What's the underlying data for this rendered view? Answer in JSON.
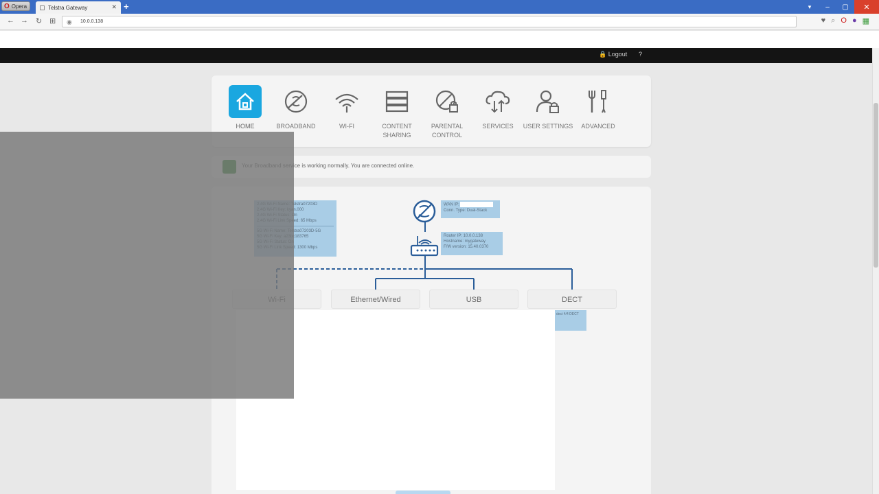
{
  "browser": {
    "menu_label": "Opera",
    "tab_title": "Telstra Gateway",
    "tab_close": "✕",
    "new_tab": "+",
    "url": "10.0.0.138",
    "window_controls": [
      "▾",
      "–",
      "▢",
      "✕"
    ]
  },
  "header": {
    "logout_label": "Logout",
    "help_label": "?"
  },
  "nav": {
    "items": [
      {
        "label": "HOME",
        "icon": "home-icon",
        "active": true
      },
      {
        "label": "BROADBAND",
        "icon": "broadband-icon"
      },
      {
        "label": "WI-FI",
        "icon": "wifi-icon"
      },
      {
        "label": "CONTENT SHARING",
        "icon": "content-sharing-icon"
      },
      {
        "label": "PARENTAL CONTROL",
        "icon": "parental-control-icon"
      },
      {
        "label": "SERVICES",
        "icon": "services-icon"
      },
      {
        "label": "USER SETTINGS",
        "icon": "user-settings-icon"
      },
      {
        "label": "ADVANCED",
        "icon": "advanced-icon"
      }
    ]
  },
  "status": {
    "message": "Your Broadband service is working normally.  You are connected online."
  },
  "diagram": {
    "wifi_info_24": [
      "2.4G Wi-Fi Name: Telstra07203D",
      "2.4G Wi-Fi Key: kyan.000",
      "2.4G Wi-Fi Status: On",
      "2.4G Wi-Fi Link Speed: 65 Mbps"
    ],
    "wifi_info_5": [
      "5G Wi-Fi Name: Telstra07203D-5G",
      "5G Wi-Fi Key: a23bc183765",
      "5G Wi-Fi Status: On",
      "5G Wi-Fi Link Speed: 1300 Mbps"
    ],
    "wan_ip_label": "WAN IP:",
    "conn_type": "Conn. Type: Dual-Stack",
    "router_info": [
      "Router IP: 10.0.0.138",
      "Hostname: mygateway",
      "F/W version: 15.40.0370"
    ],
    "dect_info": "dect 4/4 DECT",
    "tabs": [
      {
        "label": "Wi-Fi",
        "name": "tab-wifi"
      },
      {
        "label": "Ethernet/Wired",
        "name": "tab-ethernet"
      },
      {
        "label": "USB",
        "name": "tab-usb"
      },
      {
        "label": "DECT",
        "name": "tab-dect"
      }
    ],
    "line_color": "#2a5d99"
  },
  "colors": {
    "accent": "#1aa7e0",
    "topbar": "#141414",
    "status_ok": "#2e8b2e"
  }
}
